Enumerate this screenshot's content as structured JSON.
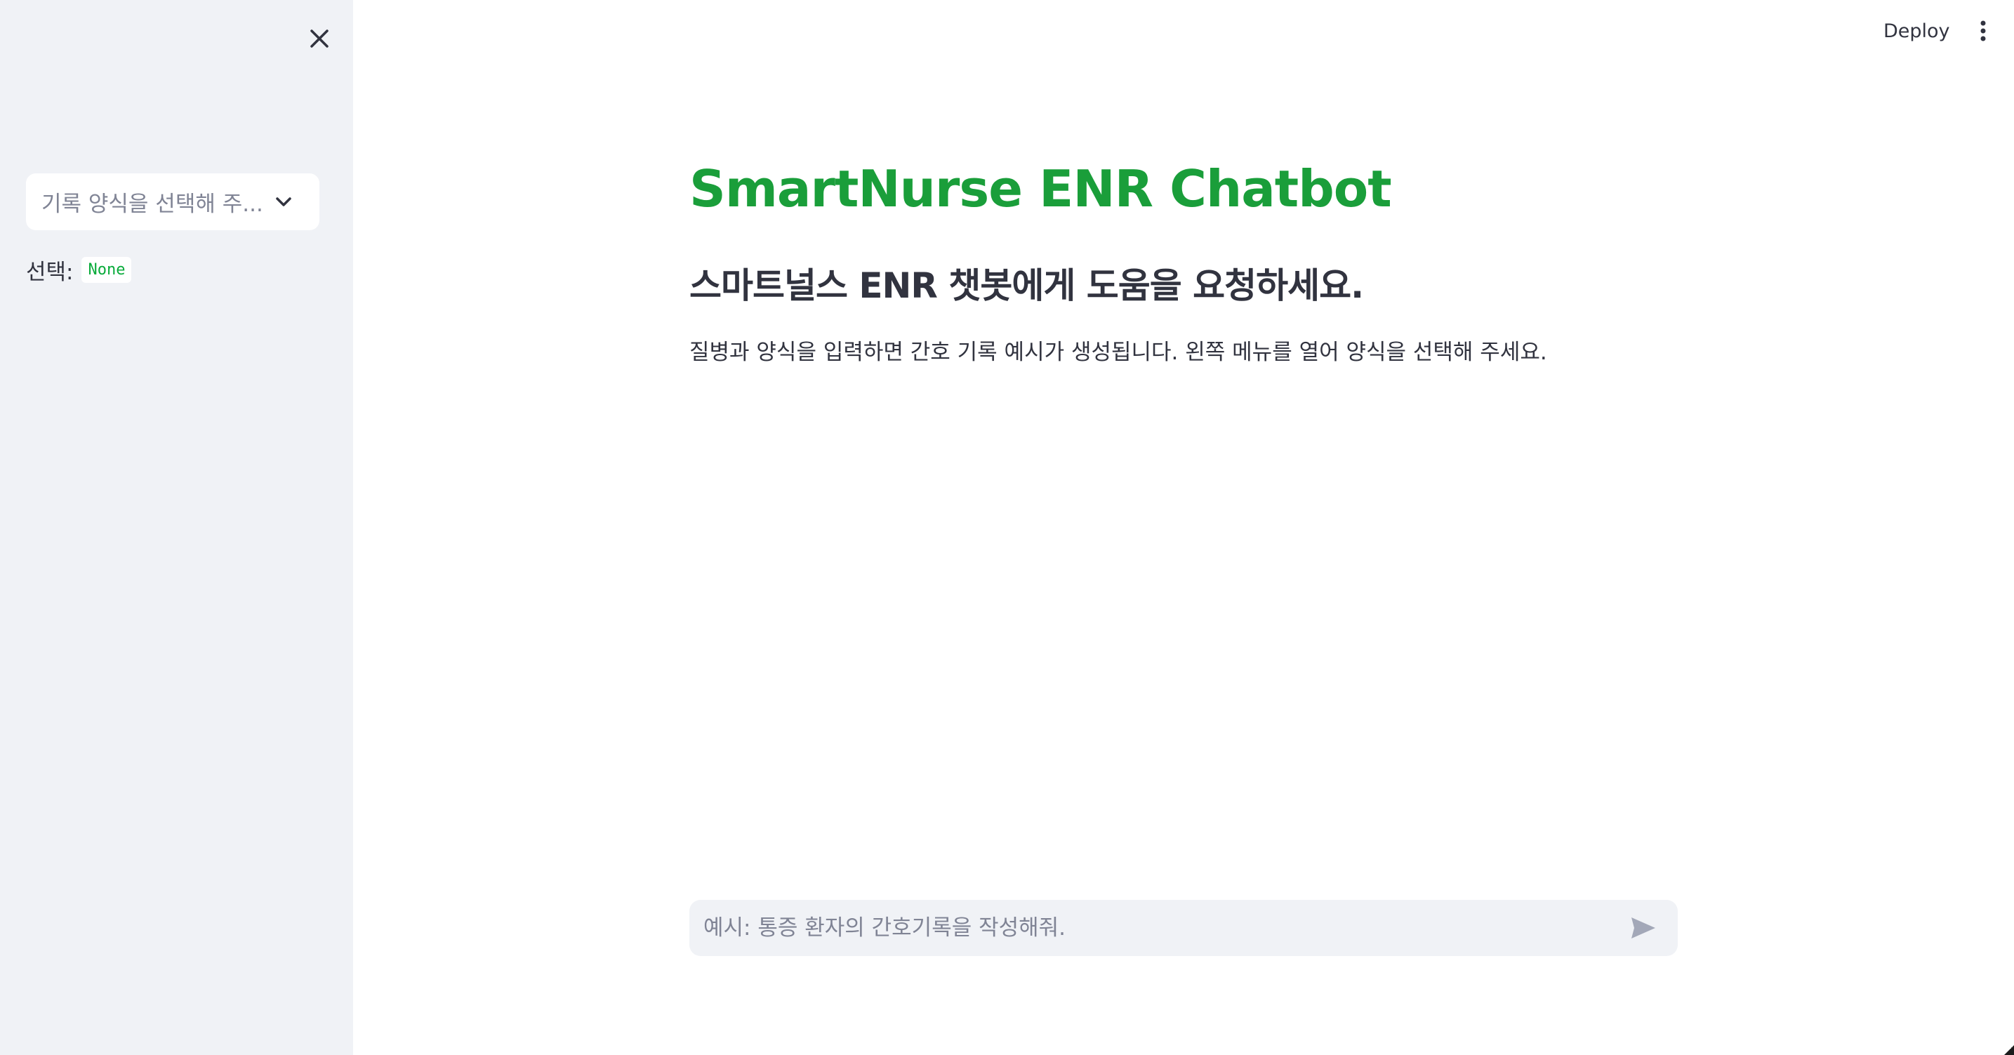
{
  "sidebar": {
    "select": {
      "placeholder": "기록 양식을 선택해 주..."
    },
    "selection": {
      "label": "선택:",
      "value": "None"
    }
  },
  "header": {
    "deploy_label": "Deploy"
  },
  "main": {
    "title": "SmartNurse ENR Chatbot",
    "subtitle": "스마트널스 ENR 챗봇에게 도움을 요청하세요.",
    "description": "질병과 양식을 입력하면 간호 기록 예시가 생성됩니다. 왼쪽 메뉴를 열어 양식을 선택해 주세요."
  },
  "chat": {
    "placeholder": "예시: 통증 환자의 간호기록을 작성해줘."
  },
  "icons": {
    "close": "close-icon",
    "chevron": "chevron-down-icon",
    "menu": "kebab-menu-icon",
    "send": "send-icon"
  },
  "colors": {
    "title": "#1a9e3a",
    "sidebar_bg": "#f0f2f6",
    "code_text": "#09ab3b",
    "placeholder": "#808495"
  }
}
